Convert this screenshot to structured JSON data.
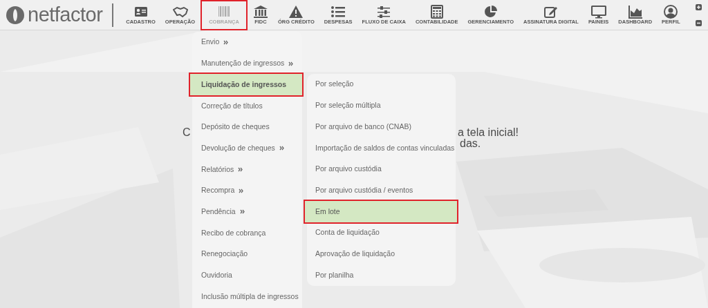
{
  "logo": {
    "text": "netfactor"
  },
  "nav": [
    {
      "label": "CADASTRO",
      "selected": false
    },
    {
      "label": "OPERAÇÃO",
      "selected": false
    },
    {
      "label": "COBRANÇA",
      "selected": true
    },
    {
      "label": "FIDC",
      "selected": false
    },
    {
      "label": "ÓRG CRÉDITO",
      "selected": false
    },
    {
      "label": "DESPESAS",
      "selected": false
    },
    {
      "label": "FLUXO DE CAIXA",
      "selected": false
    },
    {
      "label": "CONTABILIDADE",
      "selected": false
    },
    {
      "label": "GERENCIAMENTO",
      "selected": false
    },
    {
      "label": "ASSINATURA DIGITAL",
      "selected": false
    },
    {
      "label": "PAINEIS",
      "selected": false
    },
    {
      "label": "DASHBOARD",
      "selected": false
    },
    {
      "label": "PERFIL",
      "selected": false
    }
  ],
  "welcome": {
    "line_1_left": "C",
    "line_1_right": "a tela inicial!",
    "line_2_right": "das."
  },
  "menu": [
    {
      "label": "Envio",
      "has_submenu": true,
      "selected": false
    },
    {
      "label": "Manutenção de ingressos",
      "has_submenu": true,
      "selected": false
    },
    {
      "label": "Liquidação de ingressos",
      "has_submenu": false,
      "selected": true
    },
    {
      "label": "Correção de títulos",
      "has_submenu": false,
      "selected": false
    },
    {
      "label": "Depósito de cheques",
      "has_submenu": false,
      "selected": false
    },
    {
      "label": "Devolução de cheques",
      "has_submenu": true,
      "selected": false
    },
    {
      "label": "Relatórios",
      "has_submenu": true,
      "selected": false
    },
    {
      "label": "Recompra",
      "has_submenu": true,
      "selected": false
    },
    {
      "label": "Pendência",
      "has_submenu": true,
      "selected": false
    },
    {
      "label": "Recibo de cobrança",
      "has_submenu": false,
      "selected": false
    },
    {
      "label": "Renegociação",
      "has_submenu": false,
      "selected": false
    },
    {
      "label": "Ouvidoria",
      "has_submenu": false,
      "selected": false
    },
    {
      "label": "Inclusão múltipla de ingressos",
      "has_submenu": false,
      "selected": false
    }
  ],
  "submenu": [
    {
      "label": "Por seleção",
      "selected": false
    },
    {
      "label": "Por seleção múltipla",
      "selected": false
    },
    {
      "label": "Por arquivo de banco (CNAB)",
      "selected": false
    },
    {
      "label": "Importação de saldos de contas vinculadas",
      "selected": false
    },
    {
      "label": "Por arquivo custódia",
      "selected": false
    },
    {
      "label": "Por arquivo custódia / eventos",
      "selected": false
    },
    {
      "label": "Em lote",
      "selected": true
    },
    {
      "label": "Conta de liquidação",
      "selected": false
    },
    {
      "label": "Aprovação de liquidação",
      "selected": false
    },
    {
      "label": "Por planilha",
      "selected": false
    }
  ]
}
